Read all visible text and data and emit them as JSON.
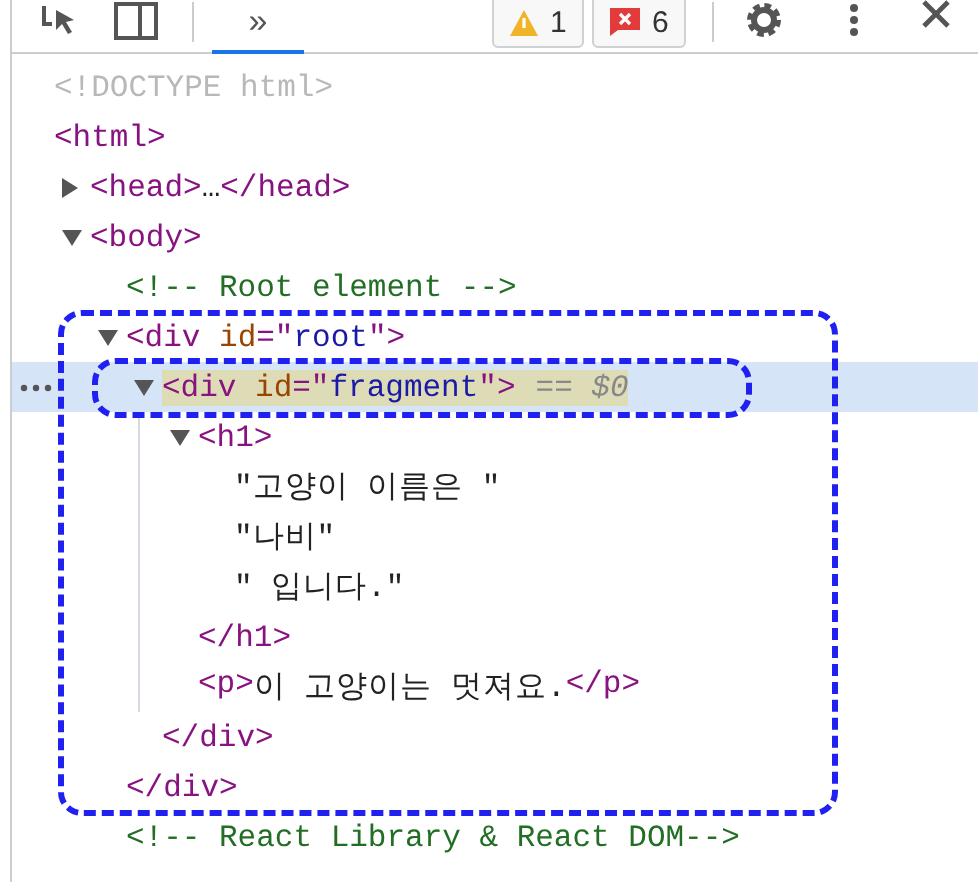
{
  "toolbar": {
    "tabs": [
      {
        "label": "»",
        "selected": true
      }
    ],
    "warnings": "1",
    "errors": "6"
  },
  "tree": [
    {
      "selected": false,
      "tokens": [
        {
          "kind": "doctype",
          "text": "<!DOCTYPE html>"
        }
      ]
    },
    {
      "selected": false,
      "tokens": [
        {
          "kind": "tag",
          "text": "<html>"
        }
      ],
      "children": [
        {
          "selected": false,
          "expanded": false,
          "tokens": [
            {
              "kind": "tag",
              "text": "<head>"
            },
            {
              "kind": "text",
              "text": "…"
            },
            {
              "kind": "tag",
              "text": "</head>"
            }
          ]
        },
        {
          "selected": false,
          "expanded": true,
          "tokens": [
            {
              "kind": "tag",
              "text": "<body>"
            }
          ],
          "children": [
            {
              "selected": false,
              "tokens": [
                {
                  "kind": "comment",
                  "text": "<!-- Root element -->"
                }
              ]
            },
            {
              "selected": false,
              "expanded": true,
              "framed": true,
              "tokens": [
                {
                  "kind": "tag",
                  "text": "<div "
                },
                {
                  "kind": "attr",
                  "text": "id"
                },
                {
                  "kind": "tag",
                  "text": "=\""
                },
                {
                  "kind": "value",
                  "text": "root"
                },
                {
                  "kind": "tag",
                  "text": "\">"
                }
              ],
              "close": [
                {
                  "kind": "tag",
                  "text": "</div>"
                }
              ],
              "children": [
                {
                  "selected": true,
                  "expanded": true,
                  "line_framed": true,
                  "tokens": [
                    {
                      "kind": "tag",
                      "text": "<div "
                    },
                    {
                      "kind": "attr",
                      "text": "id"
                    },
                    {
                      "kind": "tag",
                      "text": "=\""
                    },
                    {
                      "kind": "value",
                      "text": "fragment"
                    },
                    {
                      "kind": "tag",
                      "text": "\">"
                    },
                    {
                      "kind": "marker",
                      "text": "== $0"
                    }
                  ],
                  "close": [
                    {
                      "kind": "tag",
                      "text": "</div>"
                    }
                  ],
                  "children": [
                    {
                      "selected": false,
                      "expanded": true,
                      "tokens": [
                        {
                          "kind": "tag",
                          "text": "<h1>"
                        }
                      ],
                      "close": [
                        {
                          "kind": "tag",
                          "text": "</h1>"
                        }
                      ],
                      "children": [
                        {
                          "selected": false,
                          "tokens": [
                            {
                              "kind": "text",
                              "text": "\"고양이 이름은 \""
                            }
                          ]
                        },
                        {
                          "selected": false,
                          "tokens": [
                            {
                              "kind": "text",
                              "text": "\"나비\""
                            }
                          ]
                        },
                        {
                          "selected": false,
                          "tokens": [
                            {
                              "kind": "text",
                              "text": "\" 입니다.\""
                            }
                          ]
                        }
                      ]
                    },
                    {
                      "selected": false,
                      "tokens": [
                        {
                          "kind": "tag",
                          "text": "<p>"
                        },
                        {
                          "kind": "text",
                          "text": "이 고양이는 멋져요."
                        },
                        {
                          "kind": "tag",
                          "text": "</p>"
                        }
                      ]
                    }
                  ]
                }
              ]
            },
            {
              "selected": false,
              "tokens": [
                {
                  "kind": "comment",
                  "text": "<!-- React Library & React DOM-->"
                }
              ]
            }
          ]
        }
      ]
    }
  ]
}
